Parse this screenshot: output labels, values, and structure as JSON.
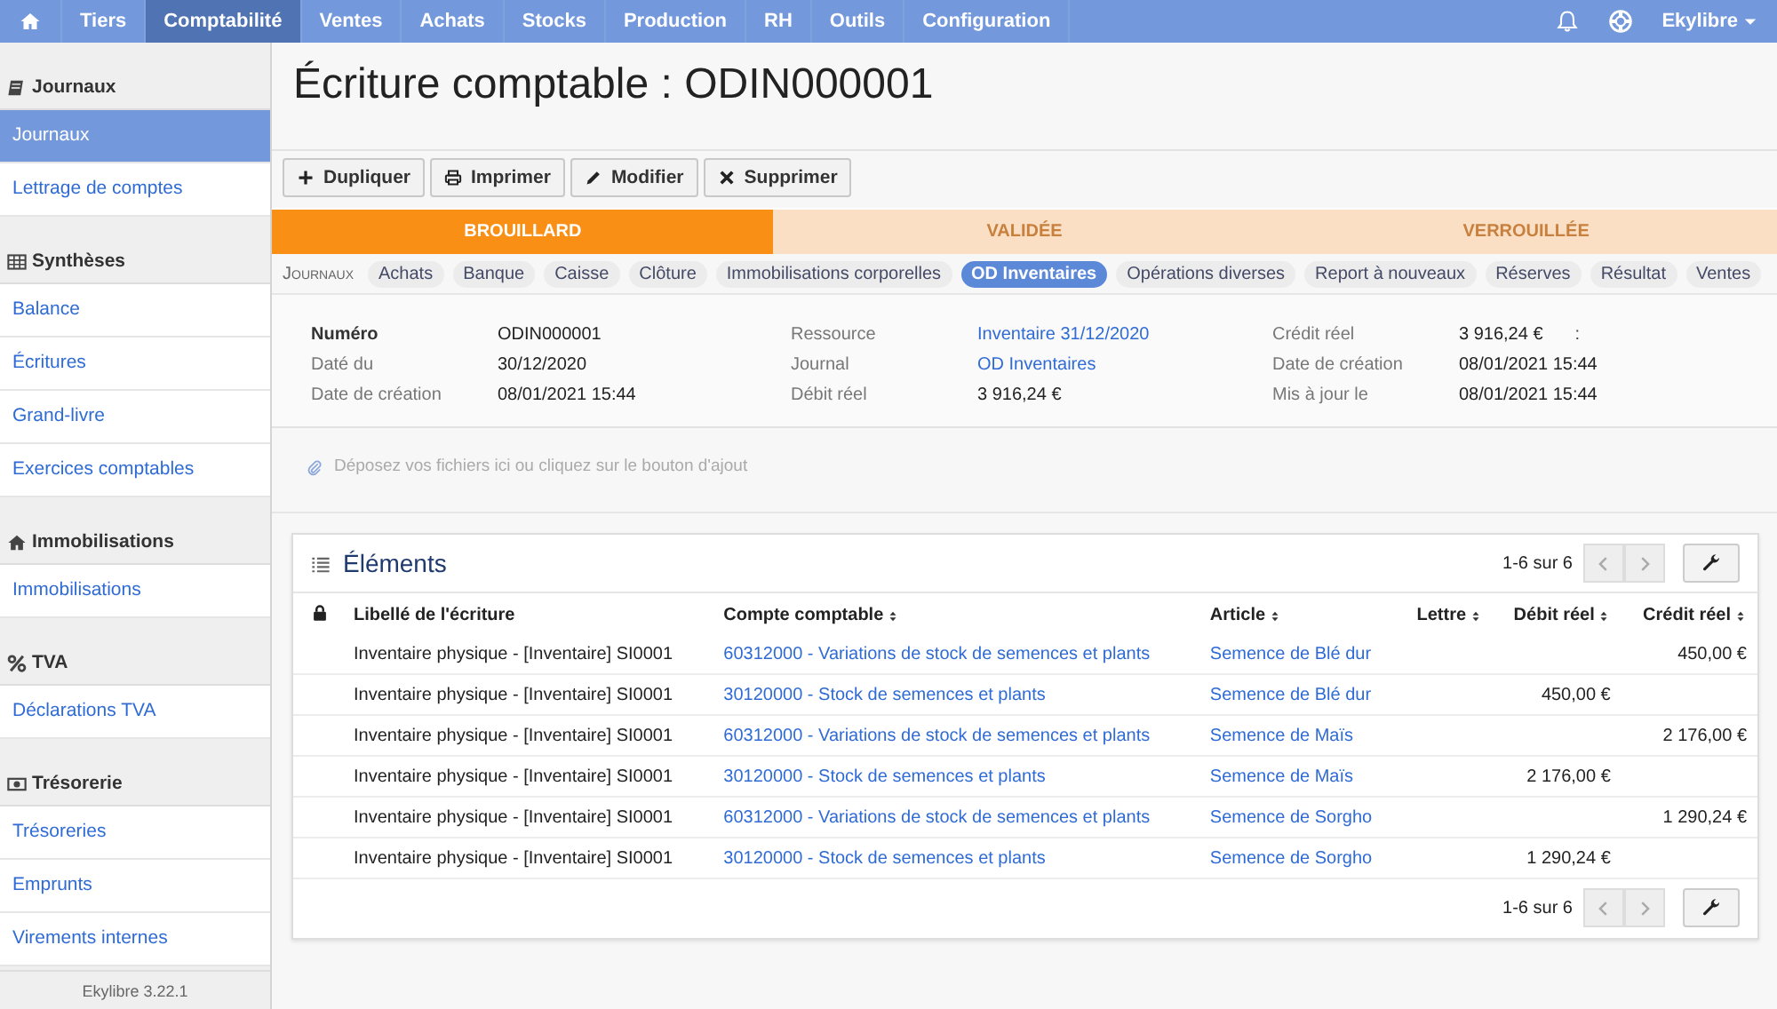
{
  "top_nav": {
    "items": [
      {
        "kind": "home",
        "selected": false
      },
      {
        "label": "Tiers",
        "selected": false
      },
      {
        "label": "Comptabilité",
        "selected": true
      },
      {
        "label": "Ventes",
        "selected": false
      },
      {
        "label": "Achats",
        "selected": false
      },
      {
        "label": "Stocks",
        "selected": false
      },
      {
        "label": "Production",
        "selected": false
      },
      {
        "label": "RH",
        "selected": false
      },
      {
        "label": "Outils",
        "selected": false
      },
      {
        "label": "Configuration",
        "selected": false
      }
    ],
    "user": "Ekylibre"
  },
  "sidebar": {
    "sections": [
      {
        "title": "Journaux",
        "kind": "book",
        "items": [
          {
            "label": "Journaux",
            "selected": true
          },
          {
            "label": "Lettrage de comptes",
            "selected": false
          }
        ]
      },
      {
        "title": "Synthèses",
        "kind": "table",
        "items": [
          {
            "label": "Balance",
            "selected": false
          },
          {
            "label": "Écritures",
            "selected": false
          },
          {
            "label": "Grand-livre",
            "selected": false
          },
          {
            "label": "Exercices comptables",
            "selected": false
          }
        ]
      },
      {
        "title": "Immobilisations",
        "kind": "home",
        "items": [
          {
            "label": "Immobilisations",
            "selected": false
          }
        ]
      },
      {
        "title": "TVA",
        "kind": "percent",
        "items": [
          {
            "label": "Déclarations TVA",
            "selected": false
          }
        ]
      },
      {
        "title": "Trésorerie",
        "kind": "money",
        "items": [
          {
            "label": "Trésoreries",
            "selected": false
          },
          {
            "label": "Emprunts",
            "selected": false
          },
          {
            "label": "Virements internes",
            "selected": false
          }
        ]
      }
    ],
    "version": "Ekylibre 3.22.1"
  },
  "page_title": "Écriture comptable : ODIN000001",
  "actions": [
    {
      "label": "Dupliquer",
      "kind": "plus"
    },
    {
      "label": "Imprimer",
      "kind": "print"
    },
    {
      "label": "Modifier",
      "kind": "pencil"
    },
    {
      "label": "Supprimer",
      "kind": "cross"
    }
  ],
  "states": [
    {
      "label": "BROUILLARD",
      "selected": true
    },
    {
      "label": "VALIDÉE",
      "selected": false
    },
    {
      "label": "VERROUILLÉE",
      "selected": false
    }
  ],
  "journals": {
    "label": "Journaux",
    "items": [
      {
        "label": "Achats",
        "selected": false
      },
      {
        "label": "Banque",
        "selected": false
      },
      {
        "label": "Caisse",
        "selected": false
      },
      {
        "label": "Clôture",
        "selected": false
      },
      {
        "label": "Immobilisations corporelles",
        "selected": false
      },
      {
        "label": "OD Inventaires",
        "selected": true
      },
      {
        "label": "Opérations diverses",
        "selected": false
      },
      {
        "label": "Report à nouveaux",
        "selected": false
      },
      {
        "label": "Réserves",
        "selected": false
      },
      {
        "label": "Résultat",
        "selected": false
      },
      {
        "label": "Ventes",
        "selected": false
      }
    ]
  },
  "details": [
    [
      {
        "label": "Numéro",
        "value": "ODIN000001",
        "strong": true
      },
      {
        "label": "Daté du",
        "value": "30/12/2020"
      },
      {
        "label": "Date de création",
        "value": "08/01/2021 15:44"
      }
    ],
    [
      {
        "label": "Ressource",
        "value": "Inventaire 31/12/2020",
        "link": true
      },
      {
        "label": "Journal",
        "value": "OD Inventaires",
        "link": true
      },
      {
        "label": "Débit réel",
        "value": "3 916,24 €"
      }
    ],
    [
      {
        "label": "Crédit réel",
        "value": "3 916,24 €",
        "note": ":"
      },
      {
        "label": "Date de création",
        "value": "08/01/2021 15:44"
      },
      {
        "label": "Mis à jour le",
        "value": "08/01/2021 15:44"
      }
    ]
  ],
  "dropzone": "Déposez vos fichiers ici ou cliquez sur le bouton d'ajout",
  "table": {
    "title": "Éléments",
    "range_top": "1-6 sur 6",
    "range_bottom": "1-6 sur 6",
    "columns": [
      {
        "label": "Libellé de l'écriture",
        "sortable": false
      },
      {
        "label": "Compte comptable",
        "sortable": true
      },
      {
        "label": "Article",
        "sortable": true
      },
      {
        "label": "Lettre",
        "sortable": true
      },
      {
        "label": "Débit réel",
        "sortable": true
      },
      {
        "label": "Crédit réel",
        "sortable": true
      }
    ],
    "rows": [
      [
        "Inventaire physique - [Inventaire] SI0001",
        "60312000 - Variations de stock de semences et plants",
        "Semence de Blé dur",
        "",
        "",
        "450,00 €"
      ],
      [
        "Inventaire physique - [Inventaire] SI0001",
        "30120000 - Stock de semences et plants",
        "Semence de Blé dur",
        "",
        "450,00 €",
        ""
      ],
      [
        "Inventaire physique - [Inventaire] SI0001",
        "60312000 - Variations de stock de semences et plants",
        "Semence de Maïs",
        "",
        "",
        "2 176,00 €"
      ],
      [
        "Inventaire physique - [Inventaire] SI0001",
        "30120000 - Stock de semences et plants",
        "Semence de Maïs",
        "",
        "2 176,00 €",
        ""
      ],
      [
        "Inventaire physique - [Inventaire] SI0001",
        "60312000 - Variations de stock de semences et plants",
        "Semence de Sorgho",
        "",
        "",
        "1 290,24 €"
      ],
      [
        "Inventaire physique - [Inventaire] SI0001",
        "30120000 - Stock de semences et plants",
        "Semence de Sorgho",
        "",
        "1 290,24 €",
        ""
      ]
    ]
  }
}
